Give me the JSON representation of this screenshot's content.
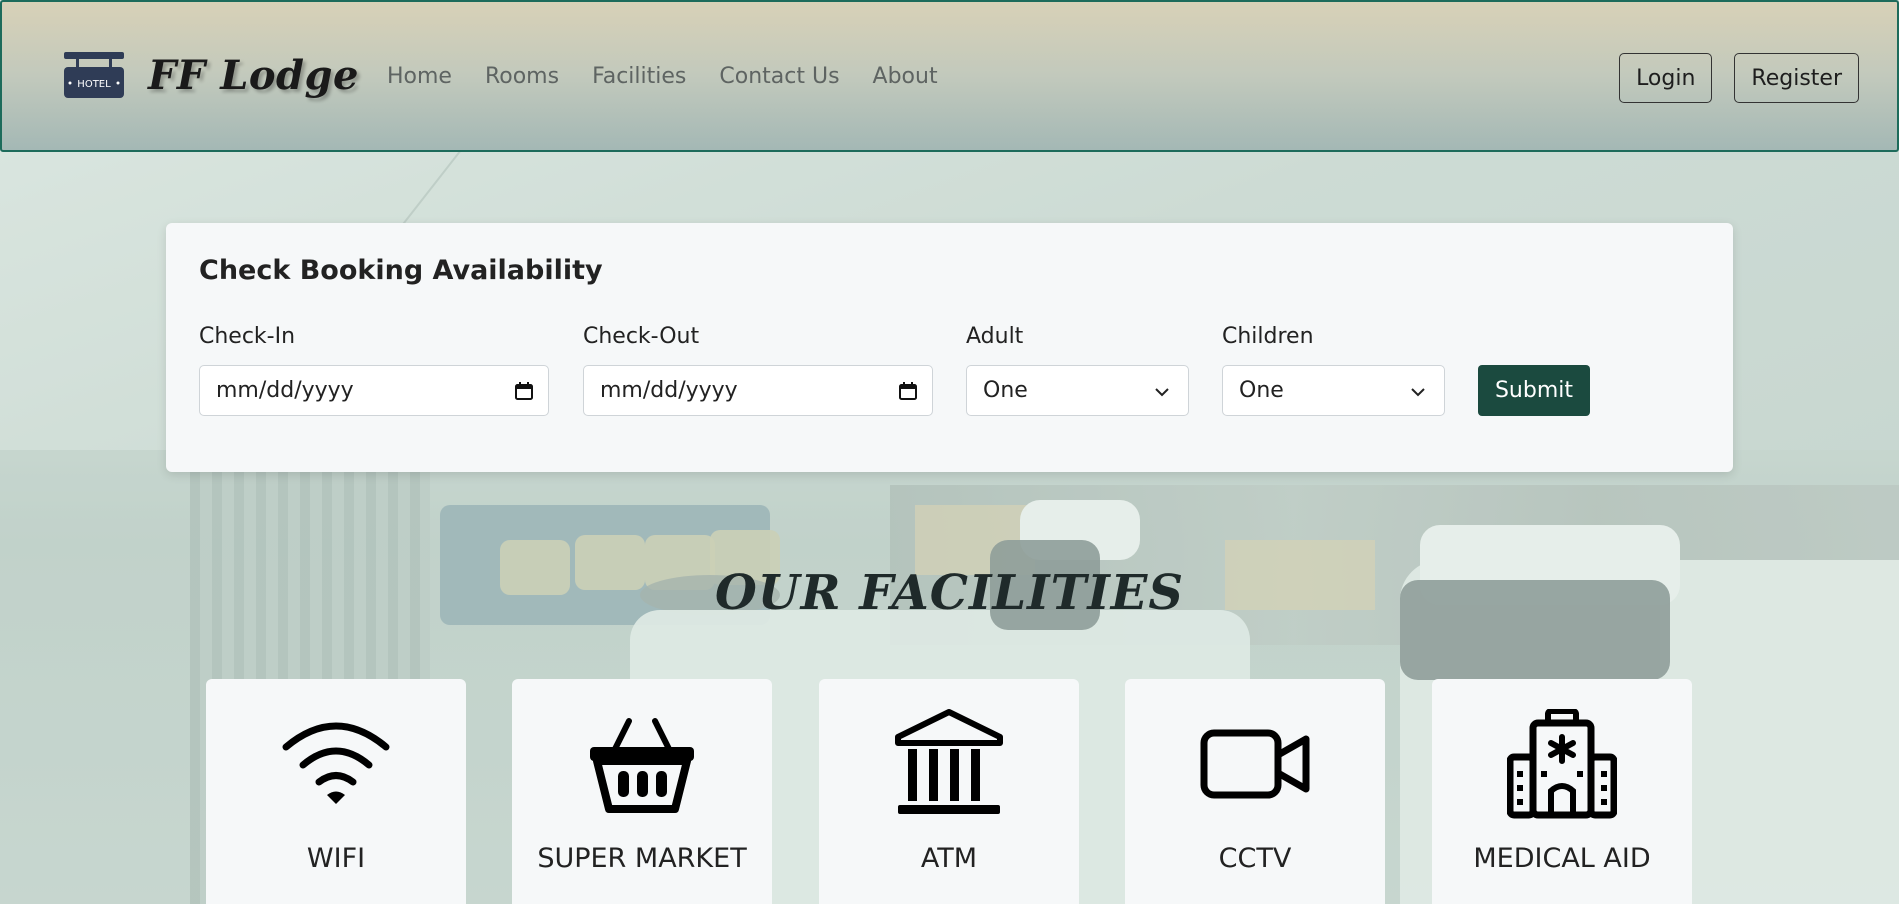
{
  "brand": {
    "name": "FF Lodge",
    "logo_text": "HOTEL",
    "logo_icon": "hotel-sign-icon"
  },
  "nav": {
    "links": [
      "Home",
      "Rooms",
      "Facilities",
      "Contact Us",
      "About"
    ],
    "login_label": "Login",
    "register_label": "Register"
  },
  "booking": {
    "title": "Check Booking Availability",
    "checkin_label": "Check-In",
    "checkin_value": "mm/dd/yyyy",
    "checkout_label": "Check-Out",
    "checkout_value": "mm/dd/yyyy",
    "adult_label": "Adult",
    "adult_value": "One",
    "children_label": "Children",
    "children_value": "One",
    "submit_label": "Submit"
  },
  "facilities": {
    "title": "OUR FACILITIES",
    "items": [
      {
        "label": "WIFI",
        "icon": "wifi-icon"
      },
      {
        "label": "SUPER MARKET",
        "icon": "basket-icon"
      },
      {
        "label": "ATM",
        "icon": "bank-icon"
      },
      {
        "label": "CCTV",
        "icon": "video-camera-icon"
      },
      {
        "label": "MEDICAL AID",
        "icon": "hospital-icon"
      }
    ]
  },
  "colors": {
    "accent": "#1b4a3f",
    "navbar_border": "#1d6b5b",
    "card_bg": "#f6f8f9"
  }
}
